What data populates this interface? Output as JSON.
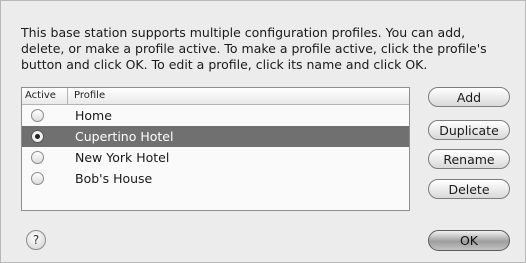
{
  "description": "This base station supports multiple configuration profiles. You can add, delete, or make a profile active. To make a profile active, click the profile's button and click OK. To edit a profile, click its name and click OK.",
  "table": {
    "headers": {
      "active": "Active",
      "profile": "Profile"
    },
    "rows": [
      {
        "label": "Home",
        "active": false,
        "selected": false
      },
      {
        "label": "Cupertino Hotel",
        "active": true,
        "selected": true
      },
      {
        "label": "New York Hotel",
        "active": false,
        "selected": false
      },
      {
        "label": "Bob's House",
        "active": false,
        "selected": false
      }
    ]
  },
  "buttons": {
    "add": "Add",
    "duplicate": "Duplicate",
    "rename": "Rename",
    "delete": "Delete",
    "ok": "OK",
    "help": "?"
  }
}
